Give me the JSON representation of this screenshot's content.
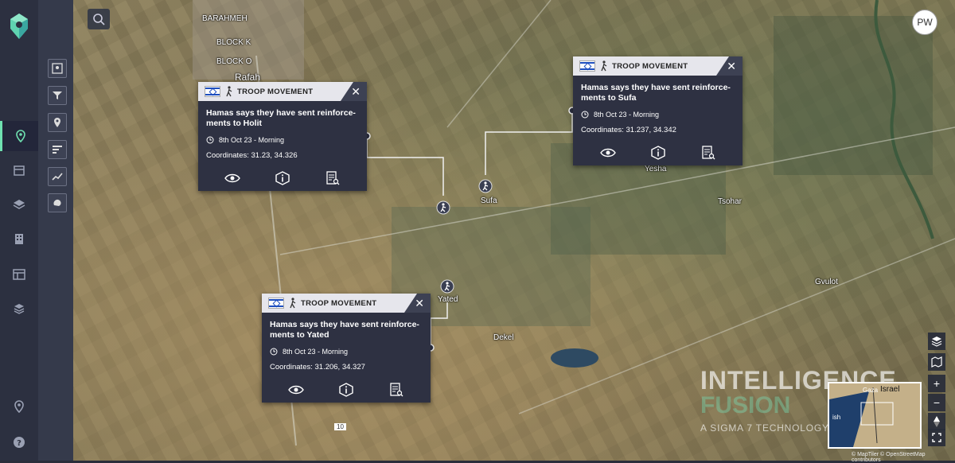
{
  "user": {
    "initials": "PW"
  },
  "map": {
    "places": {
      "rafah": "Rafah",
      "sufa": "Sufa",
      "yesha": "Yesha",
      "tsohar": "Tsohar",
      "gvulot": "Gvulot",
      "dekel": "Dekel",
      "yated": "Yated",
      "block_k": "BLOCK K",
      "block_o": "BLOCK O",
      "barahmeh": "BARAHMEH",
      "road_10": "10"
    },
    "minimap": {
      "label_left": "Gaza",
      "label_right": "Israel",
      "label_bottom": "ish"
    },
    "attribution": "© MapTiler © OpenStreetMap contributors"
  },
  "watermark": {
    "line1": "INTELLIGENCE",
    "line2": "FUSION",
    "line3": "A SIGMA 7 TECHNOLOGY"
  },
  "popups": [
    {
      "category": "TROOP MOVEMENT",
      "description": "Hamas says they have sent reinforce- ments to Holit",
      "date": "8th Oct 23 - Morning",
      "coordinates": "Coordinates: 31.23, 34.326"
    },
    {
      "category": "TROOP MOVEMENT",
      "description": "Hamas says they have sent reinforce- ments to Sufa",
      "date": "8th Oct 23 - Morning",
      "coordinates": "Coordinates: 31.237, 34.342"
    },
    {
      "category": "TROOP MOVEMENT",
      "description": "Hamas says they have sent reinforce- ments to Yated",
      "date": "8th Oct 23 - Morning",
      "coordinates": "Coordinates: 31.206, 34.327"
    }
  ],
  "colors": {
    "accent": "#6fe0b0",
    "panel": "#2e3142",
    "rail": "#2c3040"
  },
  "map_controls": {
    "zoom_in": "+",
    "zoom_out": "−"
  }
}
